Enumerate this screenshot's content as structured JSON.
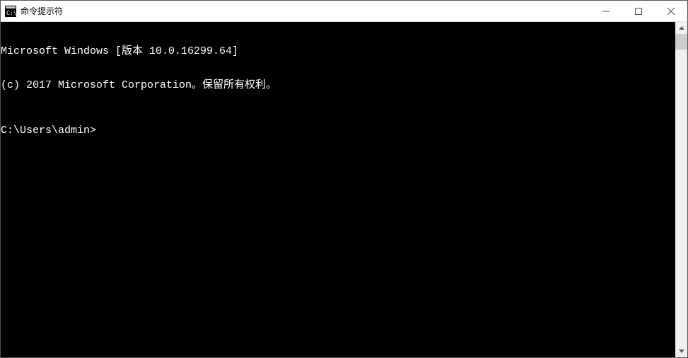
{
  "window": {
    "title": "命令提示符"
  },
  "console": {
    "line1": "Microsoft Windows [版本 10.0.16299.64]",
    "line2": "(c) 2017 Microsoft Corporation。保留所有权利。",
    "prompt": "C:\\Users\\admin>"
  }
}
